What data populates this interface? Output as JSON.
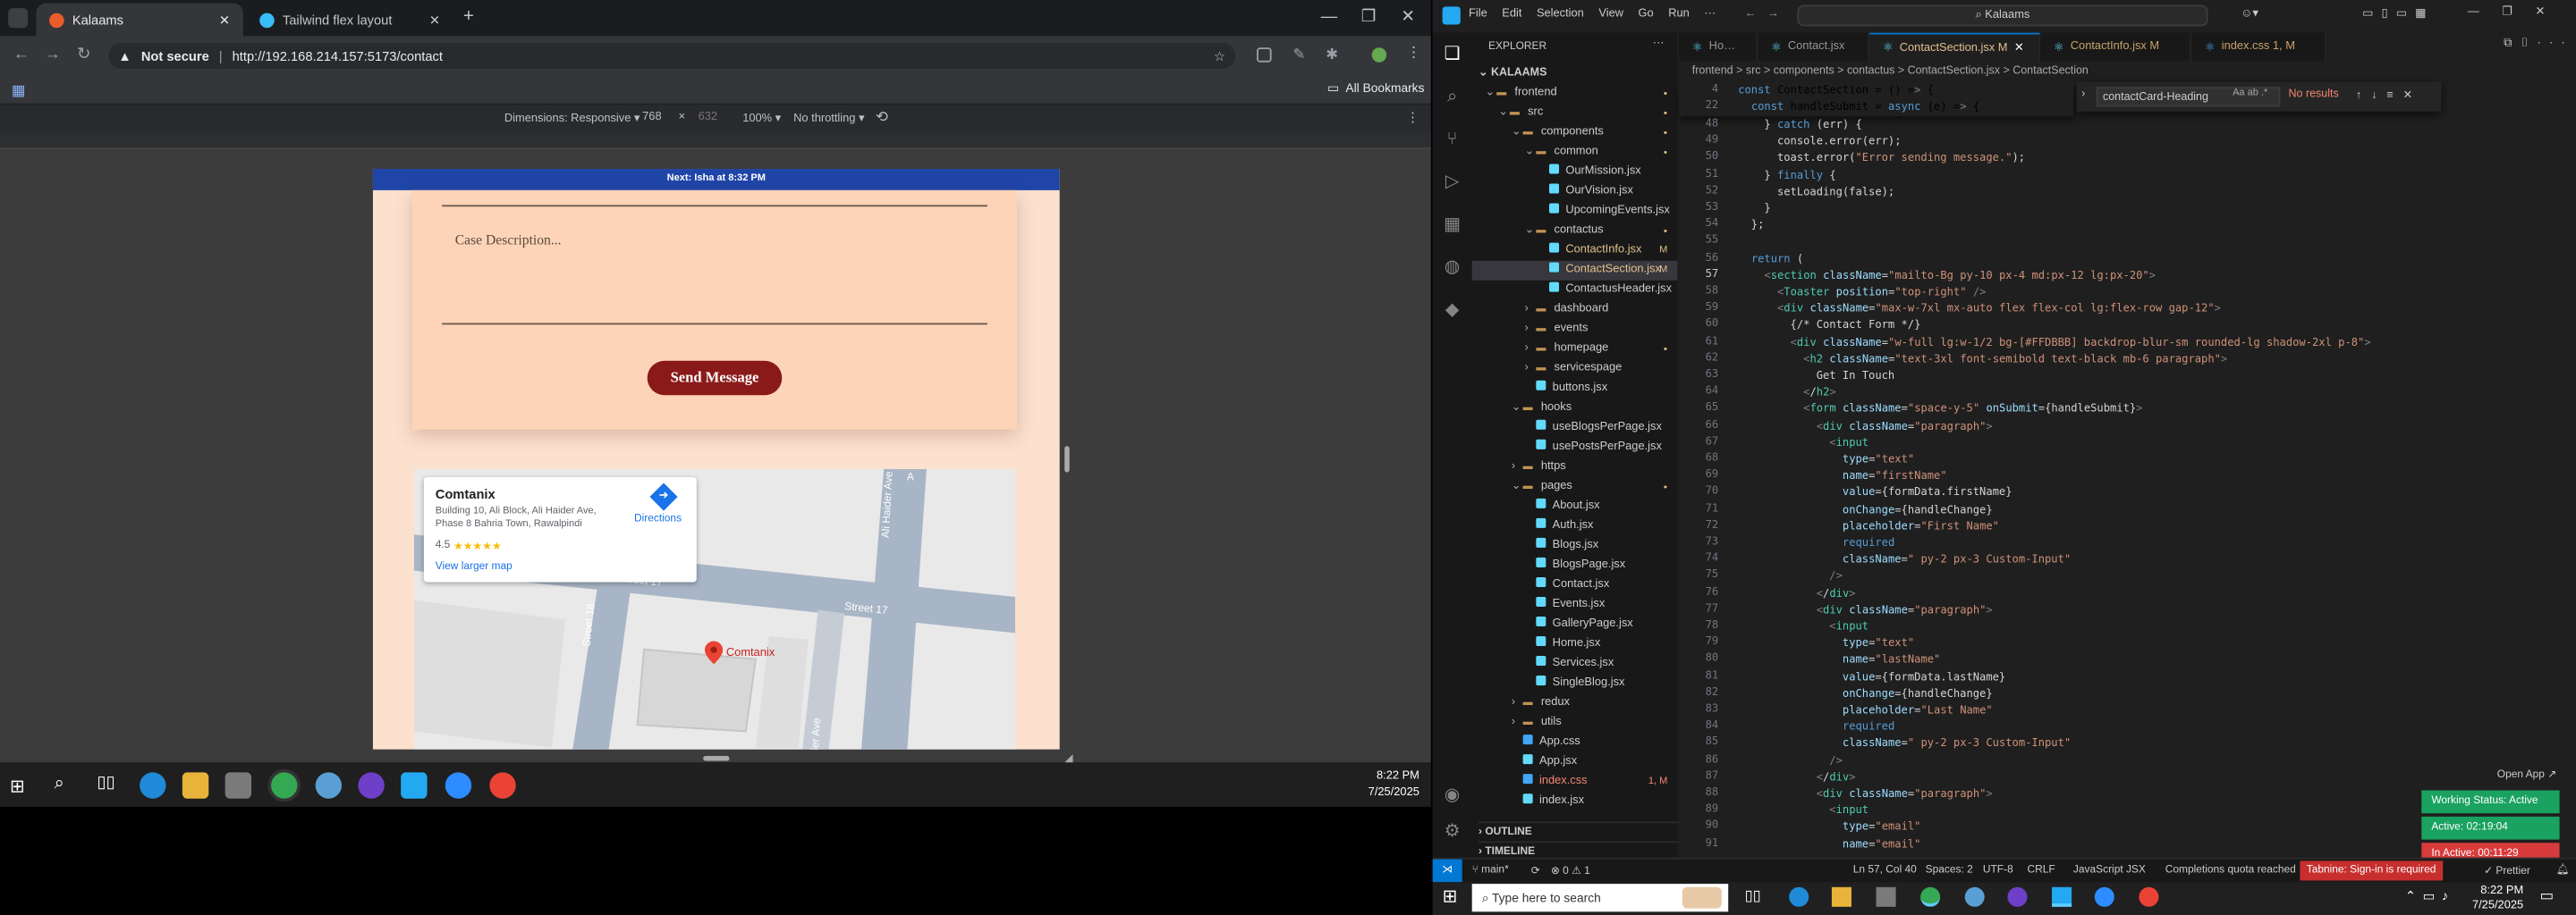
{
  "browser": {
    "tabs": [
      {
        "title": "Kalaams",
        "active": true
      },
      {
        "title": "Tailwind flex layout",
        "active": false
      }
    ],
    "url_security": "Not secure",
    "url": "http://192.168.214.157:5173/contact",
    "bookmarks_label": "All Bookmarks",
    "devtools": {
      "dimensions": "Dimensions: Responsive ▾",
      "width": "768",
      "height": "632",
      "zoom": "100% ▾",
      "throttle": "No throttling ▾"
    }
  },
  "page": {
    "announcement": "Next: Isha at 8:32 PM",
    "case_placeholder": "Case Description...",
    "send_label": "Send Message",
    "map": {
      "place": "Comtanix",
      "address": "Building 10, Ali Block, Ali Haider Ave, Phase 8 Bahria Town, Rawalpindi",
      "rating": "4.5",
      "stars": "★★★★★",
      "directions": "Directions",
      "larger_map": "View larger map",
      "street1": "Street 17",
      "street2": "Street 17",
      "street3": "Street 18",
      "avenue1": "Ali Haider Ave",
      "avenue2": "ider Ave",
      "pin_label": "Comtanix"
    }
  },
  "taskbar_left": {
    "time": "8:22 PM",
    "date": "7/25/2025"
  },
  "vscode": {
    "menu": [
      "File",
      "Edit",
      "Selection",
      "View",
      "Go",
      "Run",
      "···"
    ],
    "search": "Kalaams",
    "explorer_title": "EXPLORER",
    "project": "KALAAMS",
    "tree": [
      {
        "label": "frontend",
        "indent": 1,
        "type": "folder-open",
        "badge": "dot"
      },
      {
        "label": "src",
        "indent": 2,
        "type": "folder-open",
        "badge": "dot"
      },
      {
        "label": "components",
        "indent": 3,
        "type": "folder-open",
        "badge": "dot"
      },
      {
        "label": "common",
        "indent": 4,
        "type": "folder-open",
        "badge": "dot"
      },
      {
        "label": "OurMission.jsx",
        "indent": 5,
        "type": "file",
        "badge": ""
      },
      {
        "label": "OurVision.jsx",
        "indent": 5,
        "type": "file",
        "badge": ""
      },
      {
        "label": "UpcomingEvents.jsx",
        "indent": 5,
        "type": "file",
        "badge": ""
      },
      {
        "label": "contactus",
        "indent": 4,
        "type": "folder-open",
        "badge": "dot"
      },
      {
        "label": "ContactInfo.jsx",
        "indent": 5,
        "type": "file",
        "badge": "M"
      },
      {
        "label": "ContactSection.jsx",
        "indent": 5,
        "type": "file",
        "badge": "M",
        "selected": true
      },
      {
        "label": "ContactusHeader.jsx",
        "indent": 5,
        "type": "file",
        "badge": ""
      },
      {
        "label": "dashboard",
        "indent": 4,
        "type": "folder",
        "badge": ""
      },
      {
        "label": "events",
        "indent": 4,
        "type": "folder",
        "badge": ""
      },
      {
        "label": "homepage",
        "indent": 4,
        "type": "folder",
        "badge": "dot"
      },
      {
        "label": "servicespage",
        "indent": 4,
        "type": "folder",
        "badge": ""
      },
      {
        "label": "buttons.jsx",
        "indent": 4,
        "type": "file",
        "badge": ""
      },
      {
        "label": "hooks",
        "indent": 3,
        "type": "folder-open",
        "badge": ""
      },
      {
        "label": "useBlogsPerPage.jsx",
        "indent": 4,
        "type": "file",
        "badge": ""
      },
      {
        "label": "usePostsPerPage.jsx",
        "indent": 4,
        "type": "file",
        "badge": ""
      },
      {
        "label": "https",
        "indent": 3,
        "type": "folder",
        "badge": ""
      },
      {
        "label": "pages",
        "indent": 3,
        "type": "folder-open",
        "badge": "dot"
      },
      {
        "label": "About.jsx",
        "indent": 4,
        "type": "file",
        "badge": ""
      },
      {
        "label": "Auth.jsx",
        "indent": 4,
        "type": "file",
        "badge": ""
      },
      {
        "label": "Blogs.jsx",
        "indent": 4,
        "type": "file",
        "badge": ""
      },
      {
        "label": "BlogsPage.jsx",
        "indent": 4,
        "type": "file",
        "badge": ""
      },
      {
        "label": "Contact.jsx",
        "indent": 4,
        "type": "file",
        "badge": ""
      },
      {
        "label": "Events.jsx",
        "indent": 4,
        "type": "file",
        "badge": ""
      },
      {
        "label": "GalleryPage.jsx",
        "indent": 4,
        "type": "file",
        "badge": ""
      },
      {
        "label": "Home.jsx",
        "indent": 4,
        "type": "file",
        "badge": ""
      },
      {
        "label": "Services.jsx",
        "indent": 4,
        "type": "file",
        "badge": ""
      },
      {
        "label": "SingleBlog.jsx",
        "indent": 4,
        "type": "file",
        "badge": ""
      },
      {
        "label": "redux",
        "indent": 3,
        "type": "folder",
        "badge": ""
      },
      {
        "label": "utils",
        "indent": 3,
        "type": "folder",
        "badge": ""
      },
      {
        "label": "App.css",
        "indent": 3,
        "type": "file",
        "badge": ""
      },
      {
        "label": "App.jsx",
        "indent": 3,
        "type": "file",
        "badge": ""
      },
      {
        "label": "index.css",
        "indent": 3,
        "type": "file",
        "badge": "1, M"
      },
      {
        "label": "index.jsx",
        "indent": 3,
        "type": "file",
        "badge": ""
      }
    ],
    "outline": "OUTLINE",
    "timeline": "TIMELINE",
    "tabs": [
      {
        "label": "Home.jsx",
        "active": false
      },
      {
        "label": "Contact.jsx",
        "active": false
      },
      {
        "label": "ContactSection.jsx M",
        "active": true
      },
      {
        "label": "ContactInfo.jsx M",
        "active": false
      },
      {
        "label": "index.css 1, M",
        "active": false
      }
    ],
    "breadcrumb": "frontend > src > components > contactus > ContactSection.jsx > ContactSection",
    "find_query": "contactCard-Heading",
    "find_result": "No results",
    "sticky": [
      {
        "n": "4",
        "t": "const ContactSection = () => {"
      },
      {
        "n": "22",
        "t": "  const handleSubmit = async (e) => {"
      }
    ],
    "code": [
      {
        "n": "48",
        "t": "    } catch (err) {"
      },
      {
        "n": "49",
        "t": "      console.error(err);"
      },
      {
        "n": "50",
        "t": "      toast.error(\"Error sending message.\");"
      },
      {
        "n": "51",
        "t": "    } finally {"
      },
      {
        "n": "52",
        "t": "      setLoading(false);"
      },
      {
        "n": "53",
        "t": "    }"
      },
      {
        "n": "54",
        "t": "  };"
      },
      {
        "n": "55",
        "t": ""
      },
      {
        "n": "56",
        "t": "  return ("
      },
      {
        "n": "57",
        "t": "    <section className=\"mailto-Bg py-10 px-4 md:px-12 lg:px-20\">"
      },
      {
        "n": "58",
        "t": "      <Toaster position=\"top-right\" />"
      },
      {
        "n": "59",
        "t": "      <div className=\"max-w-7xl mx-auto flex flex-col lg:flex-row gap-12\">"
      },
      {
        "n": "60",
        "t": "        {/* Contact Form */}"
      },
      {
        "n": "61",
        "t": "        <div className=\"w-full lg:w-1/2 bg-[#FFDBBB] backdrop-blur-sm rounded-lg shadow-2xl p-8\">"
      },
      {
        "n": "62",
        "t": "          <h2 className=\"text-3xl font-semibold text-black mb-6 paragraph\">"
      },
      {
        "n": "63",
        "t": "            Get In Touch"
      },
      {
        "n": "64",
        "t": "          </h2>"
      },
      {
        "n": "65",
        "t": "          <form className=\"space-y-5\" onSubmit={handleSubmit}>"
      },
      {
        "n": "66",
        "t": "            <div className=\"paragraph\">"
      },
      {
        "n": "67",
        "t": "              <input"
      },
      {
        "n": "68",
        "t": "                type=\"text\""
      },
      {
        "n": "69",
        "t": "                name=\"firstName\""
      },
      {
        "n": "70",
        "t": "                value={formData.firstName}"
      },
      {
        "n": "71",
        "t": "                onChange={handleChange}"
      },
      {
        "n": "72",
        "t": "                placeholder=\"First Name\""
      },
      {
        "n": "73",
        "t": "                required"
      },
      {
        "n": "74",
        "t": "                className=\" py-2 px-3 Custom-Input\""
      },
      {
        "n": "75",
        "t": "              />"
      },
      {
        "n": "76",
        "t": "            </div>"
      },
      {
        "n": "77",
        "t": "            <div className=\"paragraph\">"
      },
      {
        "n": "78",
        "t": "              <input"
      },
      {
        "n": "79",
        "t": "                type=\"text\""
      },
      {
        "n": "80",
        "t": "                name=\"lastName\""
      },
      {
        "n": "81",
        "t": "                value={formData.lastName}"
      },
      {
        "n": "82",
        "t": "                onChange={handleChange}"
      },
      {
        "n": "83",
        "t": "                placeholder=\"Last Name\""
      },
      {
        "n": "84",
        "t": "                required"
      },
      {
        "n": "85",
        "t": "                className=\" py-2 px-3 Custom-Input\""
      },
      {
        "n": "86",
        "t": "              />"
      },
      {
        "n": "87",
        "t": "            </div>"
      },
      {
        "n": "88",
        "t": "            <div className=\"paragraph\">"
      },
      {
        "n": "89",
        "t": "              <input"
      },
      {
        "n": "90",
        "t": "                type=\"email\""
      },
      {
        "n": "91",
        "t": "                name=\"email\""
      }
    ],
    "open_app": "Open App ↗",
    "wakatime": [
      {
        "label": "Working Status: Active",
        "color": "#1aa260"
      },
      {
        "label": "Active: 02:19:04",
        "color": "#1aa260"
      },
      {
        "label": "In Active: 00:11:29",
        "color": "#d83b3b"
      }
    ],
    "status": {
      "branch": "main*",
      "errors": "⊗ 0 ⚠ 1",
      "position": "Ln 57, Col 40",
      "spaces": "Spaces: 2",
      "encoding": "UTF-8",
      "eol": "CRLF",
      "language": "JavaScript JSX",
      "quota": "Completions quota reached",
      "tabnine": "Tabnine: Sign-in is required",
      "prettier": "✓ Prettier"
    }
  },
  "taskbar_right": {
    "search_placeholder": "Type here to search",
    "time": "8:22 PM",
    "date": "7/25/2025"
  },
  "colors": {
    "accent": "#0078d4",
    "page_bg": "#fce1cf",
    "card_bg": "#fdd4b7",
    "send_btn": "#8a1a1a",
    "topstrip": "#1f45a8"
  }
}
